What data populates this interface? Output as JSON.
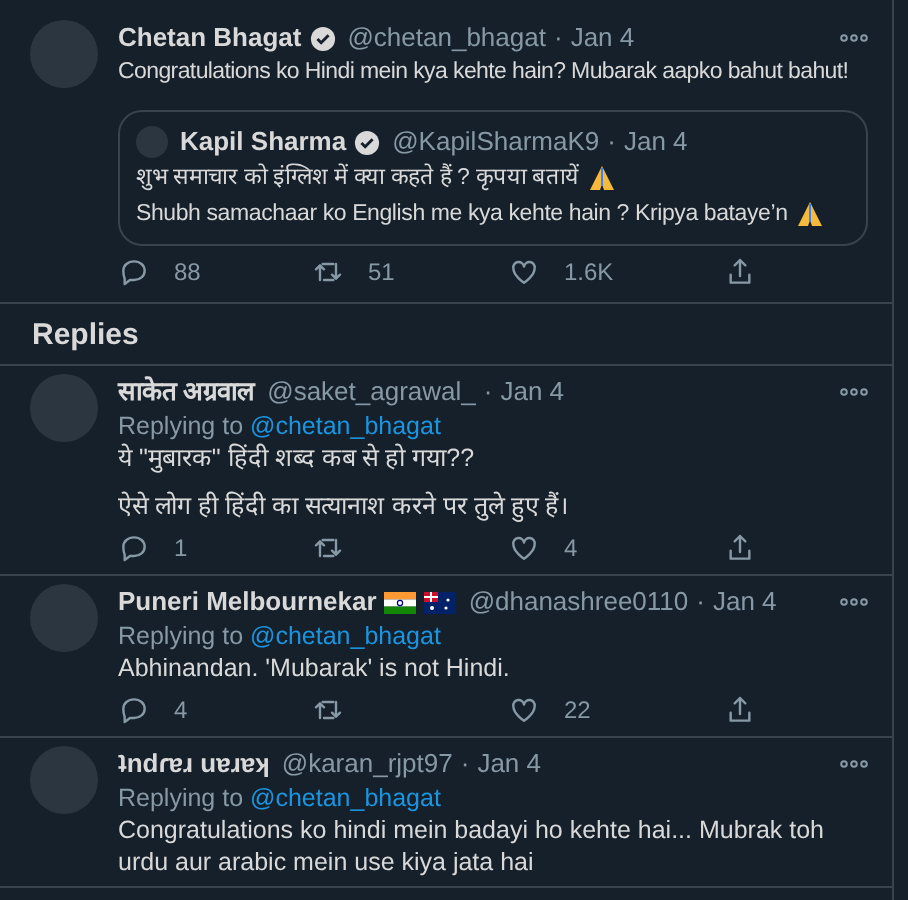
{
  "tweet": {
    "name": "Chetan Bhagat",
    "verified": true,
    "handle": "@chetan_bhagat",
    "separator": "·",
    "date": "Jan 4",
    "text": "Congratulations ko Hindi mein kya kehte hain? Mubarak aapko bahut bahut!",
    "quote": {
      "name": "Kapil Sharma",
      "verified": true,
      "handle": "@KapilSharmaK9",
      "separator": "·",
      "date": "Jan 4",
      "lines": [
        {
          "text": "शुभ समाचार को इंग्लिश में क्या कहते हैं ? कृपया बतायें",
          "emoji": true
        },
        {
          "text": "Shubh samachaar ko English me kya kehte hain ? Kripya bataye’n",
          "emoji": true
        }
      ]
    },
    "actions": {
      "replies": "88",
      "retweets": "51",
      "likes": "1.6K"
    }
  },
  "replies_heading": "Replies",
  "replies": [
    {
      "name": "साकेत अग्रवाल",
      "handle": "@saket_agrawal_",
      "separator": "·",
      "date": "Jan 4",
      "replying_label": "Replying to",
      "replying_to": "@chetan_bhagat",
      "paragraphs": [
        "ये \"मुबारक\" हिंदी शब्द कब से हो गया??",
        "ऐसे लोग ही हिंदी का सत्यानाश करने पर तुले हुए हैं।"
      ],
      "actions": {
        "replies": "1",
        "likes": "4"
      }
    },
    {
      "name": "Puneri Melbournekar",
      "flags": [
        {
          "kind": "india"
        },
        {
          "kind": "australia"
        }
      ],
      "handle": "@dhanashree0110",
      "separator": "·",
      "date": "Jan 4",
      "replying_label": "Replying to",
      "replying_to": "@chetan_bhagat",
      "paragraphs": [
        "Abhinandan. 'Mubarak' is not Hindi."
      ],
      "actions": {
        "replies": "4",
        "likes": "22"
      }
    },
    {
      "name": "ʇndɾɐɹ uɐɹɐʞ",
      "handle": "@karan_rjpt97",
      "separator": "·",
      "date": "Jan 4",
      "replying_label": "Replying to",
      "replying_to": "@chetan_bhagat",
      "paragraphs": [
        "Congratulations ko hindi mein badayi ho kehte hai... Mubrak toh urdu aur arabic mein use kiya jata hai"
      ]
    }
  ]
}
